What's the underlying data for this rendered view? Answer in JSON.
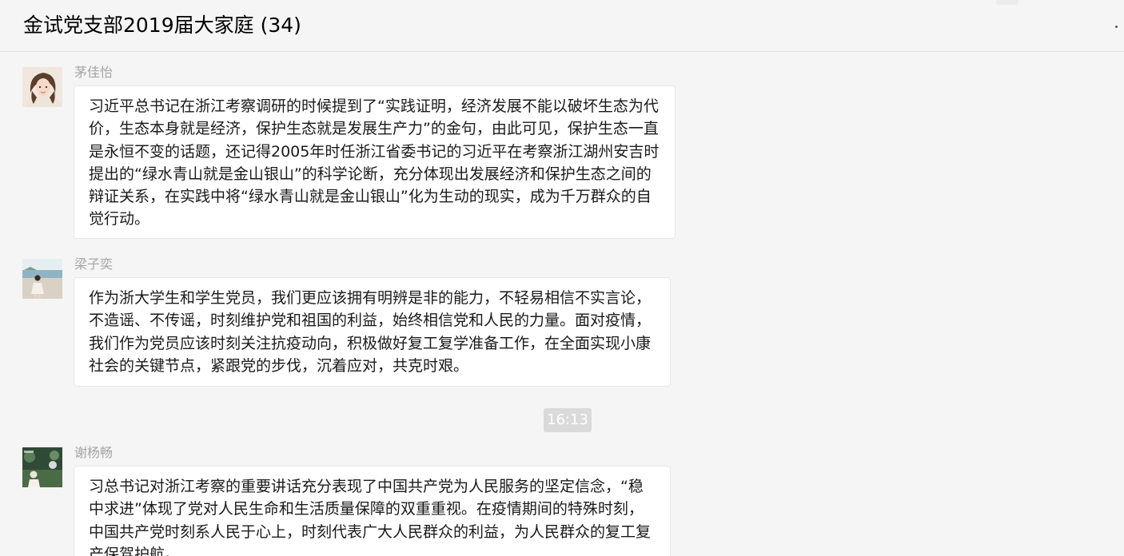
{
  "header": {
    "title": "金试党支部2019届大家庭 (34)"
  },
  "messages": [
    {
      "sender": "茅佳怡",
      "text": "习近平总书记在浙江考察调研的时候提到了“实践证明，经济发展不能以破坏生态为代价，生态本身就是经济，保护生态就是发展生产力”的金句，由此可见，保护生态一直是永恒不变的话题，还记得2005年时任浙江省委书记的习近平在考察浙江湖州安吉时提出的“绿水青山就是金山银山”的科学论断，充分体现出发展经济和保护生态之间的辩证关系，在实践中将“绿水青山就是金山银山”化为生动的现实，成为千万群众的自觉行动。"
    },
    {
      "sender": "梁子奕",
      "text": "作为浙大学生和学生党员，我们更应该拥有明辨是非的能力，不轻易相信不实言论，不造谣、不传谣，时刻维护党和祖国的利益，始终相信党和人民的力量。面对疫情，我们作为党员应该时刻关注抗疫动向，积极做好复工复学准备工作，在全面实现小康社会的关键节点，紧跟党的步伐，沉着应对，共克时艰。"
    },
    {
      "sender": "谢杨畅",
      "text": "习总书记对浙江考察的重要讲话充分表现了中国共产党为人民服务的坚定信念，“稳中求进”体现了党对人民生命和生活质量保障的双重重视。在疫情期间的特殊时刻，中国共产党时刻系人民于心上，时刻代表广大人民群众的利益，为人民群众的复工复产保驾护航。"
    }
  ],
  "timestamp": "16:13",
  "icons": {
    "more": "more-dots-icon"
  },
  "colors": {
    "background": "#f5f5f5",
    "bubble": "#ffffff",
    "sender_name": "#a5a5a5",
    "time_chip": "#dadada"
  }
}
